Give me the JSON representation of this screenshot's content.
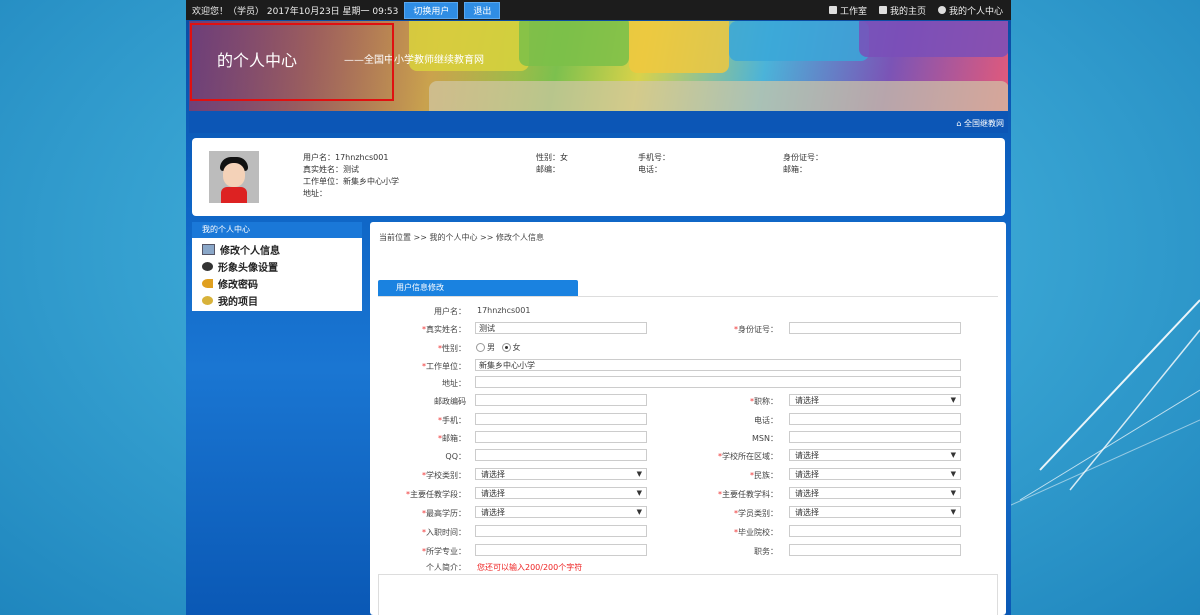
{
  "topbar": {
    "greeting": "欢迎您！（学员） 2017年10月23日 星期一 09:53",
    "switch_user": "切换用户",
    "logout": "退出",
    "workshop": "工作室",
    "my_home": "我的主页",
    "my_center": "我的个人中心"
  },
  "banner": {
    "title": "的个人中心",
    "subtitle": "——全国中小学教师继续教育网",
    "home_link": "全国继教网"
  },
  "profile": {
    "username_label": "用户名：",
    "username": "17hnzhcs001",
    "realname_label": "真实姓名：",
    "realname": "测试",
    "workunit_label": "工作单位：",
    "workunit": "新集乡中心小学",
    "address_label": "地址：",
    "gender_label": "性别：",
    "gender": "女",
    "postcode_label": "邮编：",
    "mobile_label": "手机号：",
    "phone_label": "电话：",
    "idcard_label": "身份证号：",
    "email_label": "邮箱："
  },
  "sidebar": {
    "head": "我的个人中心",
    "items": [
      {
        "label": "修改个人信息",
        "icon": "id-card-icon"
      },
      {
        "label": "形象头像设置",
        "icon": "avatar-icon"
      },
      {
        "label": "修改密码",
        "icon": "key-icon"
      },
      {
        "label": "我的项目",
        "icon": "project-icon"
      }
    ]
  },
  "main": {
    "breadcrumb": "当前位置 >> 我的个人中心 >> 修改个人信息",
    "section_title": "用户信息修改",
    "form": {
      "username_label": "用户名：",
      "username_value": "17hnzhcs001",
      "realname_label": "真实姓名：",
      "realname_value": "测试",
      "idcard_label": "身份证号：",
      "gender_label": "性别：",
      "gender_male": "男",
      "gender_female": "女",
      "gender_selected": "女",
      "workunit_label": "工作单位：",
      "workunit_value": "新集乡中心小学",
      "address_label": "地址：",
      "postcode_label": "邮政编码",
      "title_label": "职称：",
      "mobile_label": "手机：",
      "phone_label": "电话：",
      "email_label": "邮箱：",
      "msn_label": "MSN：",
      "qq_label": "QQ：",
      "school_region_label": "学校所在区域：",
      "school_type_label": "学校类别：",
      "ethnicity_label": "民族：",
      "main_stage_label": "主要任教学段：",
      "main_subject_label": "主要任教学科：",
      "education_label": "最高学历：",
      "student_type_label": "学员类别：",
      "entry_time_label": "入职时间：",
      "grad_school_label": "毕业院校：",
      "major_label": "所学专业：",
      "position_label": "职务：",
      "intro_label": "个人简介：",
      "intro_hint": "您还可以输入200/200个字符",
      "select_placeholder": "请选择"
    }
  },
  "colors": {
    "accent": "#1a82e0",
    "required": "#e33333",
    "topbar": "#1c1c1c"
  }
}
